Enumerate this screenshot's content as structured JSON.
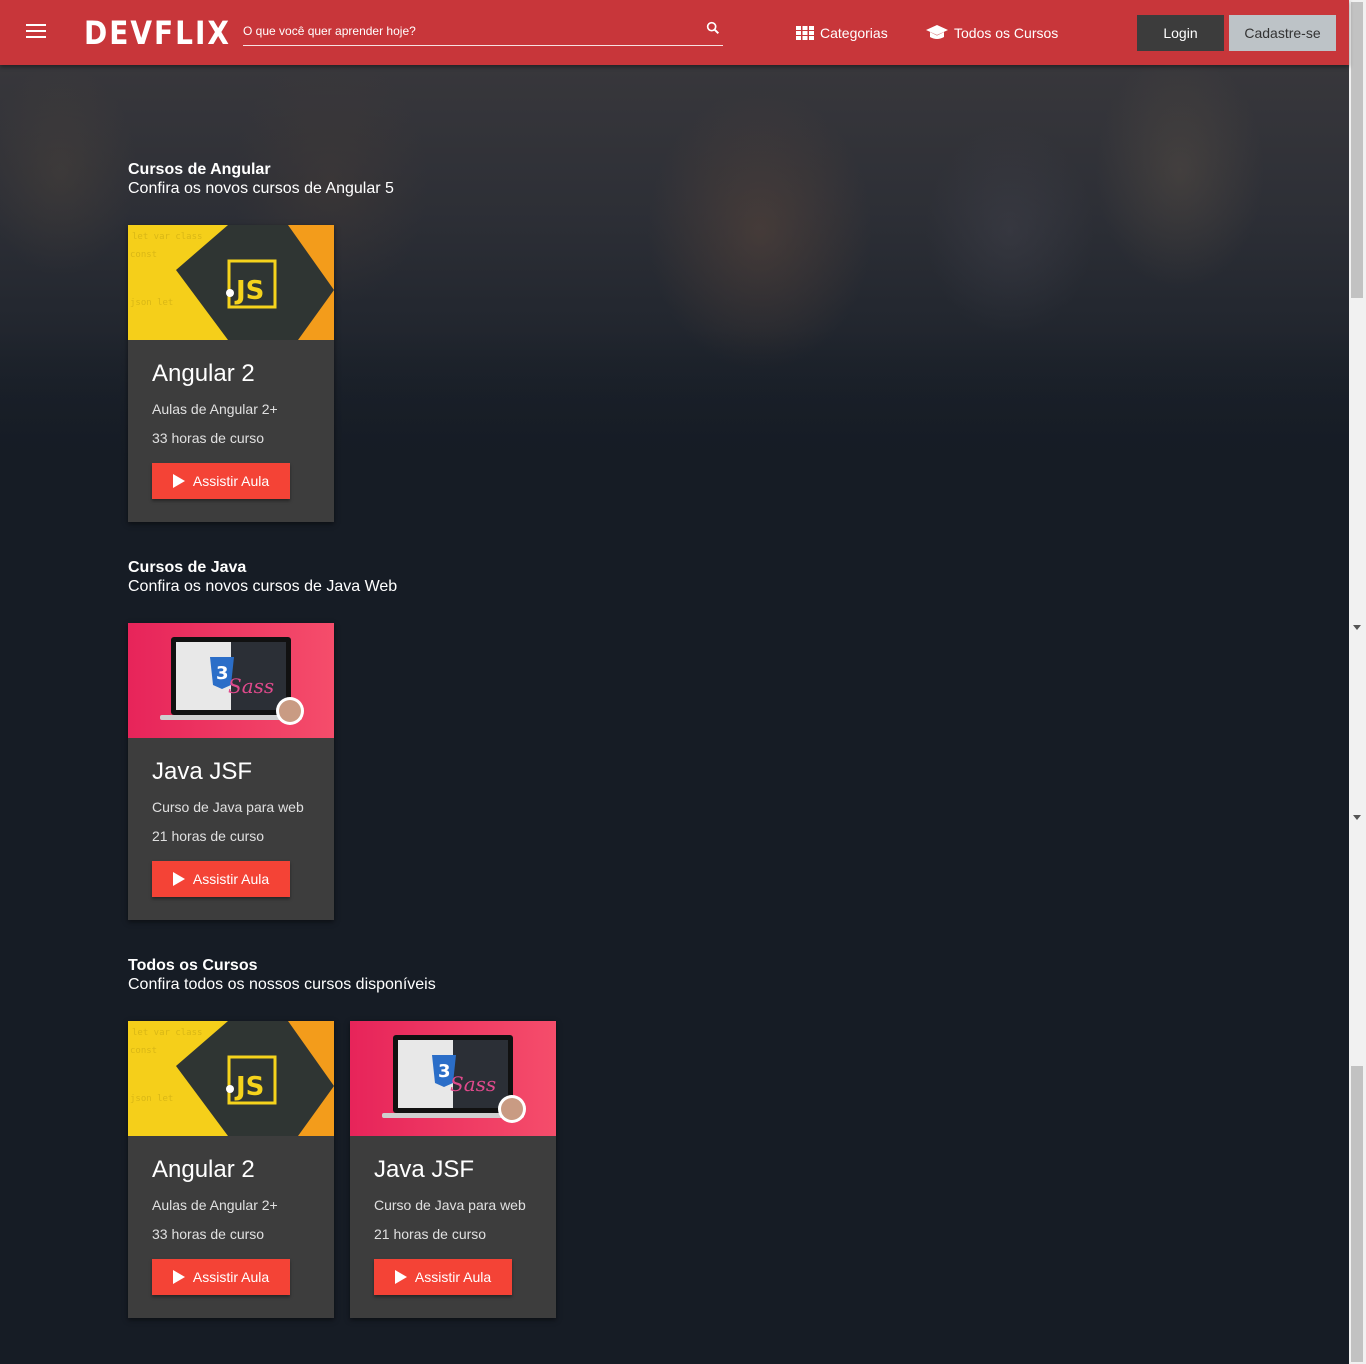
{
  "header": {
    "logo": "DEVFLIX",
    "search_placeholder": "O que você quer aprender hoje?",
    "nav": [
      {
        "label": "Categorias",
        "icon": "grid-icon"
      },
      {
        "label": "Todos os Cursos",
        "icon": "graduation-cap-icon"
      }
    ],
    "login_label": "Login",
    "signup_label": "Cadastre-se"
  },
  "colors": {
    "header": "#c8363a",
    "background": "#161c25",
    "card": "#3d3d3d",
    "accent": "#f44336"
  },
  "sections": [
    {
      "title": "Cursos de Angular",
      "subtitle": "Confira os novos cursos de Angular 5",
      "courses": [
        {
          "title": "Angular 2",
          "description": "Aulas de Angular 2+",
          "hours": "33 horas de curso",
          "button": "Assistir Aula",
          "thumb": "js-thumbnail"
        }
      ]
    },
    {
      "title": "Cursos de Java",
      "subtitle": "Confira os novos cursos de Java Web",
      "courses": [
        {
          "title": "Java JSF",
          "description": "Curso de Java para web",
          "hours": "21 horas de curso",
          "button": "Assistir Aula",
          "thumb": "css-sass-thumbnail"
        }
      ]
    },
    {
      "title": "Todos os Cursos",
      "subtitle": "Confira todos os nossos cursos disponíveis",
      "courses": [
        {
          "title": "Angular 2",
          "description": "Aulas de Angular 2+",
          "hours": "33 horas de curso",
          "button": "Assistir Aula",
          "thumb": "js-thumbnail"
        },
        {
          "title": "Java JSF",
          "description": "Curso de Java para web",
          "hours": "21 horas de curso",
          "button": "Assistir Aula",
          "thumb": "css-sass-thumbnail"
        }
      ]
    }
  ]
}
